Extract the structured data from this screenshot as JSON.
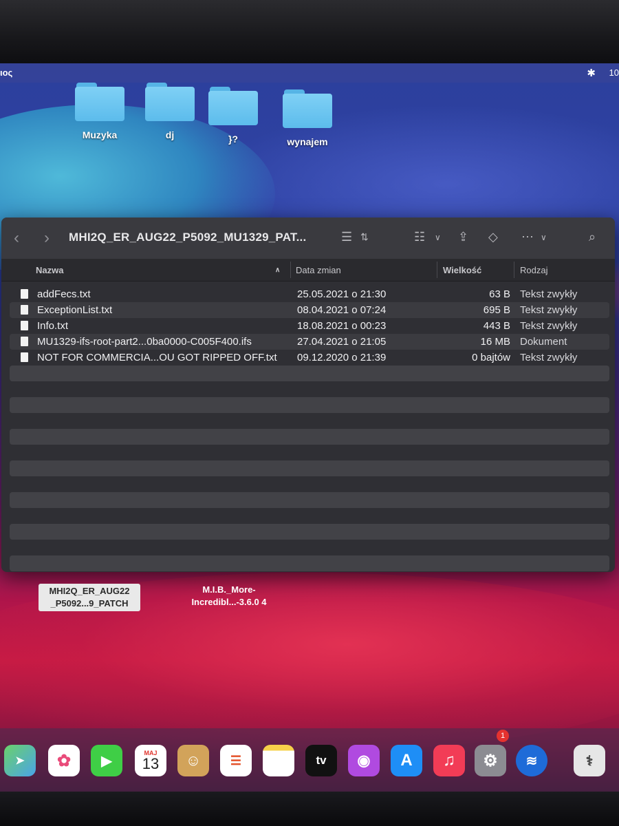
{
  "menubar": {
    "app_fragment": "ιος",
    "clock_fragment": "10"
  },
  "desktop_folders": [
    {
      "label": "Muzyka"
    },
    {
      "label": "dj"
    },
    {
      "label": "}?"
    },
    {
      "label": "wynajem"
    }
  ],
  "finder": {
    "title": "MHI2Q_ER_AUG22_P5092_MU1329_PAT...",
    "columns": {
      "name": "Nazwa",
      "date": "Data zmian",
      "size": "Wielkość",
      "kind": "Rodzaj"
    },
    "files": [
      {
        "name": "addFecs.txt",
        "date": "25.05.2021 o 21:30",
        "size": "63 B",
        "kind": "Tekst zwykły"
      },
      {
        "name": "ExceptionList.txt",
        "date": "08.04.2021 o 07:24",
        "size": "695 B",
        "kind": "Tekst zwykły"
      },
      {
        "name": "Info.txt",
        "date": "18.08.2021 o 00:23",
        "size": "443 B",
        "kind": "Tekst zwykły"
      },
      {
        "name": "MU1329-ifs-root-part2...0ba0000-C005F400.ifs",
        "date": "27.04.2021 o 21:05",
        "size": "16 MB",
        "kind": "Dokument"
      },
      {
        "name": "NOT FOR COMMERCIA...OU GOT RIPPED OFF.txt",
        "date": "09.12.2020 o 21:39",
        "size": "0 bajtów",
        "kind": "Tekst zwykły"
      }
    ]
  },
  "desktop_items": {
    "item1": {
      "line1": "MHI2Q_ER_AUG22",
      "line2": "_P5092...9_PATCH"
    },
    "item2": {
      "line1": "M.I.B._More-",
      "line2": "Incredibl...-3.6.0 4"
    }
  },
  "dock": {
    "calendar_month": "MAJ",
    "calendar_day": "13",
    "tv_label": "tv",
    "settings_badge": "1"
  }
}
